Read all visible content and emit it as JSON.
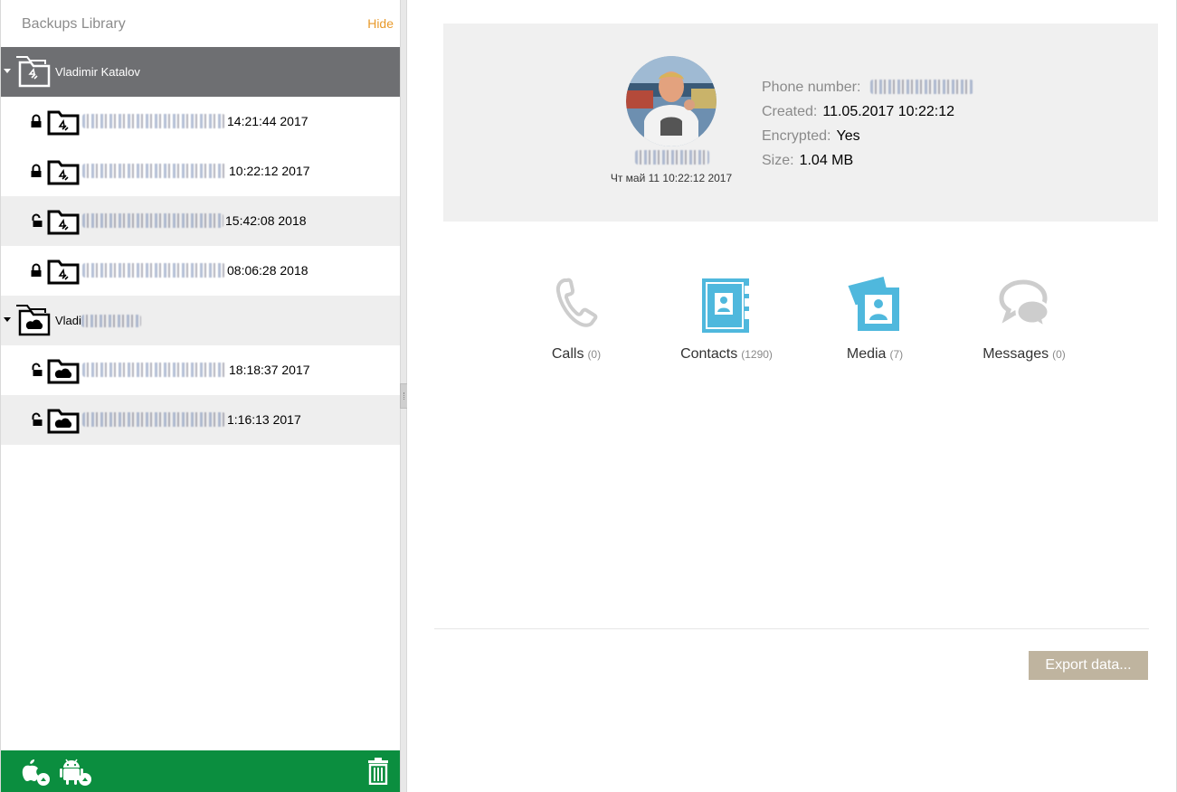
{
  "sidebar": {
    "title": "Backups Library",
    "hide_label": "Hide",
    "groups": [
      {
        "name": "Vladimir Katalov",
        "platform": "ios",
        "backups": [
          {
            "time": "14:21:44 2017",
            "locked": true
          },
          {
            "time": "10:22:12 2017",
            "locked": true
          },
          {
            "time": "15:42:08 2018",
            "locked": false
          },
          {
            "time": "08:06:28 2018",
            "locked": true
          }
        ]
      },
      {
        "name": "Vladi",
        "platform": "icloud",
        "backups": [
          {
            "time": "18:18:37 2017",
            "locked": false
          },
          {
            "time": "1:16:13 2017",
            "locked": false
          }
        ]
      }
    ],
    "footer": {
      "add_ios_icon": "apple-add-icon",
      "add_android_icon": "android-add-icon",
      "delete_icon": "trash-icon"
    }
  },
  "device": {
    "date": "Чт май 11 10:22:12 2017",
    "phone_label": "Phone number:",
    "created_label": "Created:",
    "created_value": "11.05.2017 10:22:12",
    "encrypted_label": "Encrypted:",
    "encrypted_value": "Yes",
    "size_label": "Size:",
    "size_value": "1.04 MB"
  },
  "categories": [
    {
      "label": "Calls",
      "count": "(0)",
      "icon": "phone-icon"
    },
    {
      "label": "Contacts",
      "count": "(1290)",
      "icon": "contacts-icon"
    },
    {
      "label": "Media",
      "count": "(7)",
      "icon": "media-icon"
    },
    {
      "label": "Messages",
      "count": "(0)",
      "icon": "messages-icon"
    }
  ],
  "export_label": "Export data...",
  "colors": {
    "accent_orange": "#e89a2b",
    "footer_green": "#0b8e3f",
    "selected_row": "#6e6f72",
    "icon_blue": "#4fb8dd",
    "icon_gray": "#cccccc",
    "export_button": "#bfb49f"
  }
}
